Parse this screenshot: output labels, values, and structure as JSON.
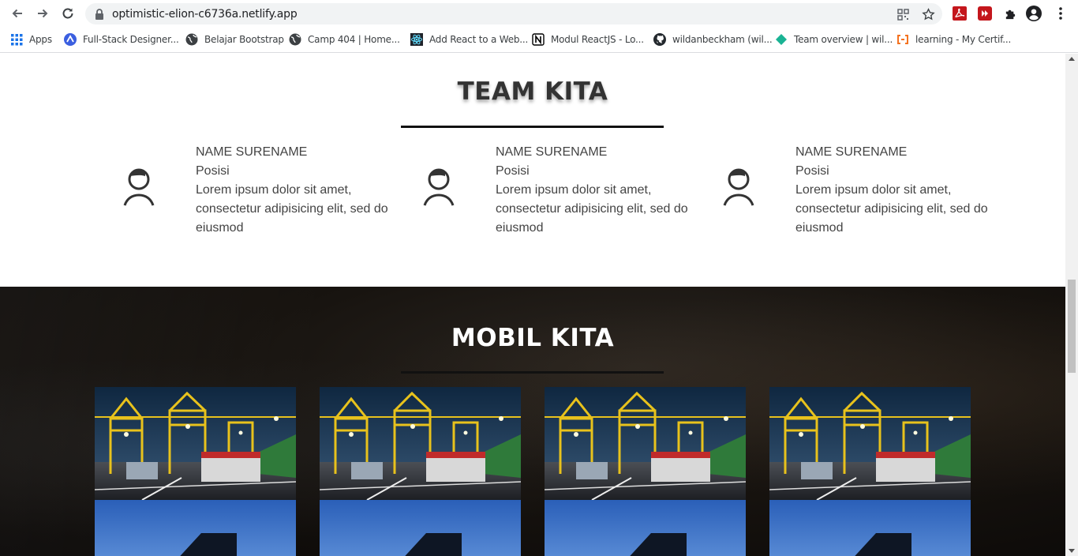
{
  "browser": {
    "url": "optimistic-elion-c6736a.netlify.app",
    "bookmarks": [
      {
        "label": "Apps",
        "icon": "apps-grid-icon"
      },
      {
        "label": "Full-Stack Designer...",
        "icon": "designer-logo-icon"
      },
      {
        "label": "Belajar Bootstrap",
        "icon": "globe-icon"
      },
      {
        "label": "Camp 404 | Home...",
        "icon": "globe-icon"
      },
      {
        "label": "Add React to a Web...",
        "icon": "react-icon"
      },
      {
        "label": "Modul ReactJS - Lo...",
        "icon": "notion-icon"
      },
      {
        "label": "wildanbeckham (wil...",
        "icon": "github-icon"
      },
      {
        "label": "Team overview | wil...",
        "icon": "diamond-icon"
      },
      {
        "label": "learning - My Certif...",
        "icon": "code-bracket-icon"
      }
    ]
  },
  "team": {
    "title": "TEAM KITA",
    "members": [
      {
        "name": "NAME SURENAME",
        "role": "Posisi",
        "desc": "Lorem ipsum dolor sit amet, consectetur adipisicing elit, sed do eiusmod"
      },
      {
        "name": "NAME SURENAME",
        "role": "Posisi",
        "desc": "Lorem ipsum dolor sit amet, consectetur adipisicing elit, sed do eiusmod"
      },
      {
        "name": "NAME SURENAME",
        "role": "Posisi",
        "desc": "Lorem ipsum dolor sit amet, consectetur adipisicing elit, sed do eiusmod"
      }
    ]
  },
  "cars": {
    "title": "MOBIL KITA",
    "images": [
      "port-crane-truck-photo",
      "port-crane-truck-photo",
      "port-crane-truck-photo",
      "port-crane-truck-photo",
      "container-sky-photo",
      "container-sky-photo",
      "container-sky-photo",
      "container-sky-photo"
    ]
  },
  "colors": {
    "chrome_bg": "#ffffff",
    "omnibox_bg": "#f1f3f4",
    "heading_dark": "#333333",
    "accent_line": "#111111",
    "cars_bg": "#120f0c"
  }
}
